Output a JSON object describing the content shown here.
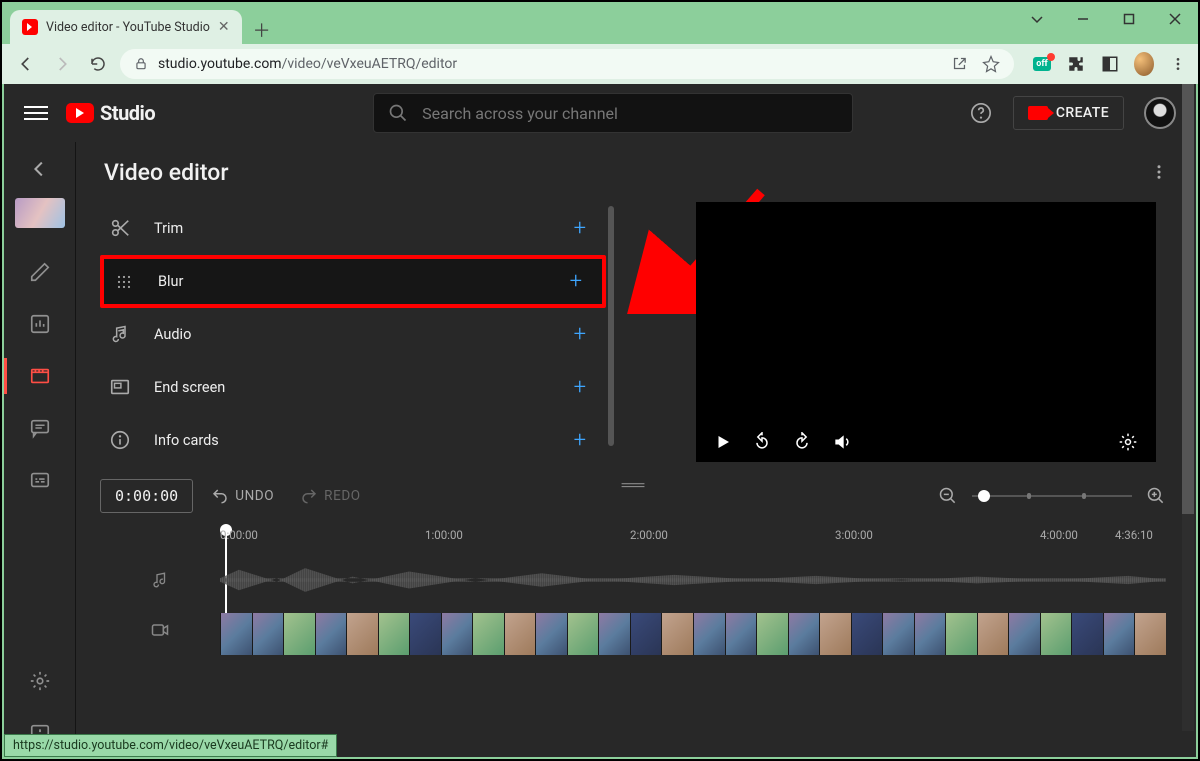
{
  "window": {
    "tab_title": "Video editor - YouTube Studio"
  },
  "chrome": {
    "url_host": "studio.youtube.com",
    "url_path": "/video/veVxeuAETRQ/editor"
  },
  "header": {
    "logo_text": "Studio",
    "search_placeholder": "Search across your channel",
    "create_label": "CREATE"
  },
  "page": {
    "title": "Video editor"
  },
  "tools": [
    {
      "icon": "scissors",
      "label": "Trim"
    },
    {
      "icon": "blur",
      "label": "Blur",
      "highlighted": true
    },
    {
      "icon": "audio",
      "label": "Audio"
    },
    {
      "icon": "endscreen",
      "label": "End screen"
    },
    {
      "icon": "info",
      "label": "Info cards"
    }
  ],
  "timeline": {
    "current_time": "0:00:00",
    "undo_label": "UNDO",
    "redo_label": "REDO",
    "ticks": [
      "0:00:00",
      "1:00:00",
      "2:00:00",
      "3:00:00",
      "4:00:00",
      "4:36:10"
    ]
  },
  "status": {
    "link": "https://studio.youtube.com/video/veVxeuAETRQ/editor#"
  }
}
